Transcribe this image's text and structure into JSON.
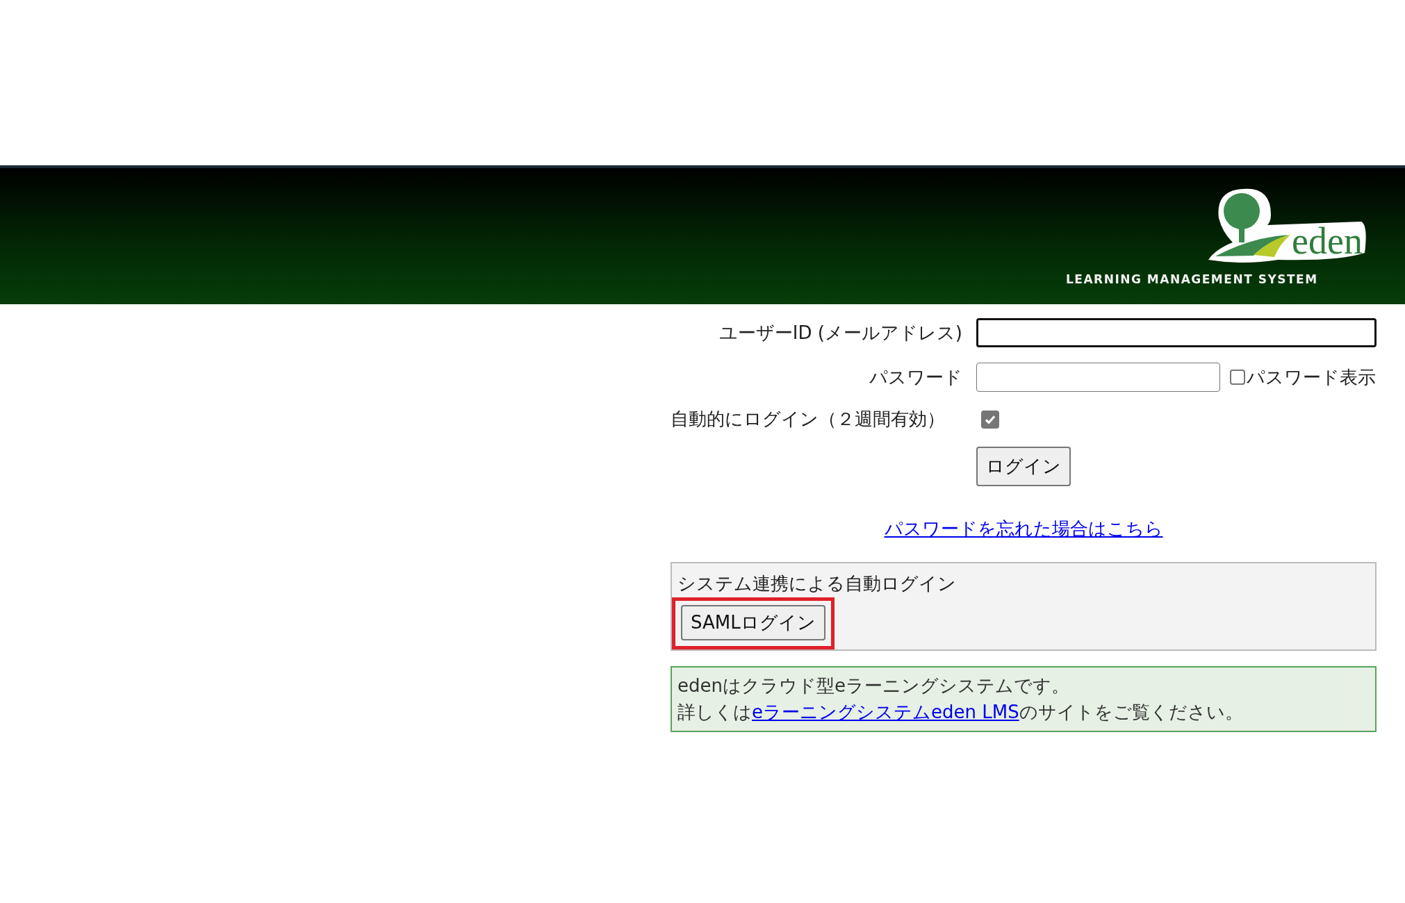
{
  "header": {
    "logo_word": "eden",
    "logo_tagline": "LEARNING MANAGEMENT SYSTEM"
  },
  "login_form": {
    "user_id": {
      "label": "ユーザーID (メールアドレス)",
      "focused": true
    },
    "password": {
      "label": "パスワード",
      "show_password": {
        "label": "パスワード表示",
        "checked": false
      }
    },
    "auto_login": {
      "label": "自動的にログイン（２週間有効）",
      "checked": true
    },
    "login_button": "ログイン",
    "forgot_link": "パスワードを忘れた場合はこちら"
  },
  "saml_panel": {
    "title": "システム連携による自動ログイン",
    "button": "SAMLログイン",
    "highlighted": true
  },
  "info_box": {
    "line_1": "edenはクラウド型eラーニングシステムです。",
    "line_2_before": "詳しくは",
    "line_2_link": "eラーニングシステムeden LMS",
    "line_2_after": "のサイトをご覧ください。"
  }
}
